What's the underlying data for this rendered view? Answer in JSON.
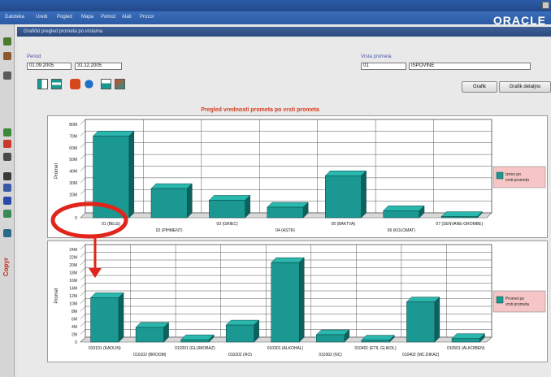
{
  "brand": "ORACLE",
  "menu": [
    "Datoteka",
    "Uredi",
    "Pogled",
    "Mapa",
    "Pomoć",
    "Alati",
    "Prozor"
  ],
  "inner_window_title": "Grafički pregled prometa po vrstama",
  "form": {
    "period_label": "Period",
    "date_from": "01.09.2005",
    "date_to": "31.12.2005",
    "vrsta_label": "Vrsta prometa",
    "vrsta_code": "01",
    "vrsta_name": "ISPOVINE"
  },
  "buttons": {
    "grafikon": "Grafik",
    "grafikon_detalj": "Grafik detaljno"
  },
  "chart_title": "Pregled vrednosti prometa po vrsti prometa",
  "left_toolbar_label": "Copyr",
  "colors": {
    "bar": "#1a9891",
    "bar_top": "#29b7ae",
    "bar_side": "#0c625e",
    "accent": "#e1251b",
    "legend_bg": "#f6c6c6"
  },
  "chart_data": [
    {
      "type": "bar",
      "ylabel": "Promet",
      "yticks": [
        "0",
        "10M",
        "20M",
        "30M",
        "40M",
        "50M",
        "60M",
        "70M",
        "80M"
      ],
      "ylim": [
        0,
        80
      ],
      "categories": [
        "01 (BELE)",
        "02 (PIHMENT)",
        "03 (GRIEC)",
        "04 (ASTR)",
        "05 (BAKTVA)",
        "06 (KOLOMAT)",
        "07 (SENVANE-GROMBE)"
      ],
      "values": [
        70,
        25,
        15,
        9,
        36,
        6,
        1
      ],
      "legend": "Iznos po vrsti prometa",
      "legend_position": "right",
      "grid": true
    },
    {
      "type": "bar",
      "ylabel": "Promet",
      "yticks": [
        "0",
        "2M",
        "4M",
        "6M",
        "8M",
        "10M",
        "12M",
        "14M",
        "16M",
        "18M",
        "20M",
        "22M",
        "24M"
      ],
      "ylim": [
        0,
        24
      ],
      "categories": [
        "010101 (KAOLIN)",
        "010102 (BROOM)",
        "010201 (GLUMOBAZ)",
        "010202 (RO)",
        "010301 (ALKOHAL)",
        "010302 (NC)",
        "010401 (ETIL GLIKOL)",
        "010402 (MC.DIKAZ)",
        "010501 (ALKOIBEN)"
      ],
      "values": [
        11.5,
        3.8,
        0.6,
        4.4,
        20.6,
        1.9,
        0.5,
        10.4,
        0.9
      ],
      "legend": "Promet po vrsti prometa",
      "legend_position": "right",
      "grid": true
    }
  ]
}
